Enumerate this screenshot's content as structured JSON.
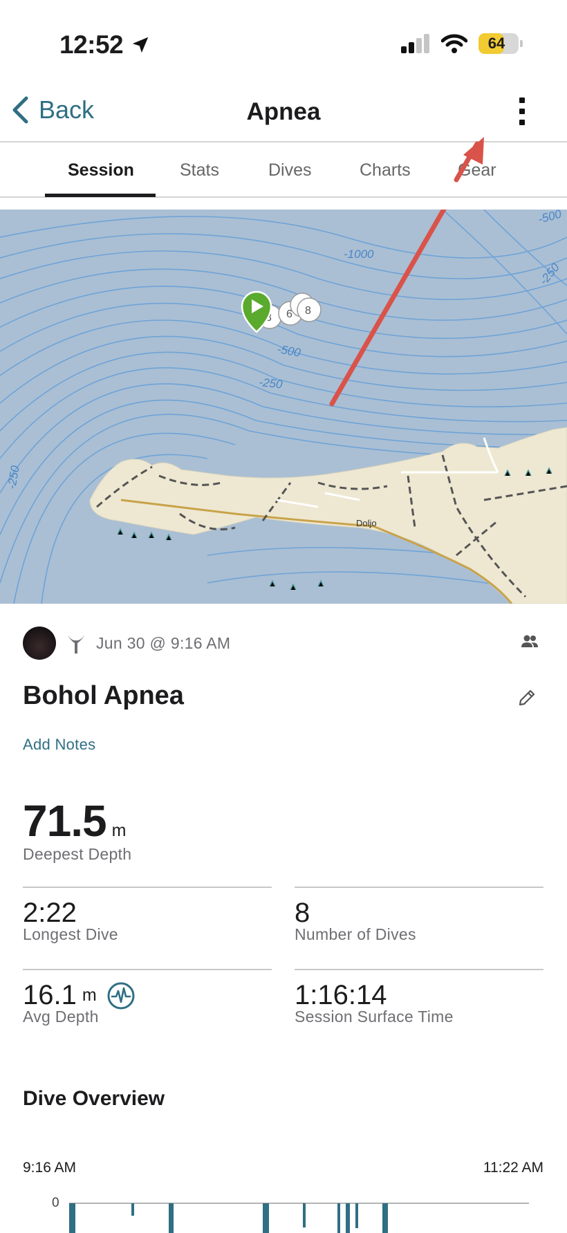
{
  "status_bar": {
    "time": "12:52",
    "battery": "64",
    "battery_level": 0.64
  },
  "nav": {
    "back_label": "Back",
    "title": "Apnea"
  },
  "tabs": [
    {
      "label": "Session"
    },
    {
      "label": "Stats"
    },
    {
      "label": "Dives"
    },
    {
      "label": "Charts"
    },
    {
      "label": "Gear"
    }
  ],
  "map": {
    "contour_labels": [
      "-1000",
      "-500",
      "-250",
      "-250",
      "-500",
      "-250"
    ],
    "marker_labels": [
      "3",
      "6",
      "8"
    ],
    "place_name": "Doljo"
  },
  "activity": {
    "date": "Jun 30 @ 9:16 AM",
    "title": "Bohol Apnea",
    "add_notes": "Add Notes"
  },
  "stats": {
    "deepest": {
      "value": "71.5",
      "unit": "m",
      "label": "Deepest Depth"
    },
    "longest_dive": {
      "value": "2:22",
      "label": "Longest Dive"
    },
    "num_dives": {
      "value": "8",
      "label": "Number of Dives"
    },
    "avg_depth": {
      "value": "16.1",
      "unit": "m",
      "label": "Avg Depth"
    },
    "surface_time": {
      "value": "1:16:14",
      "label": "Session Surface Time"
    }
  },
  "overview": {
    "title": "Dive Overview",
    "start_time": "9:16 AM",
    "end_time": "11:22 AM",
    "zero_label": "0"
  },
  "colors": {
    "accent": "#2f6f83",
    "water": "#aabfd4",
    "contour": "#6fa3d6",
    "land": "#eee8d2",
    "marker_green": "#5aaa2e",
    "annotation_arrow": "#d9534a"
  }
}
